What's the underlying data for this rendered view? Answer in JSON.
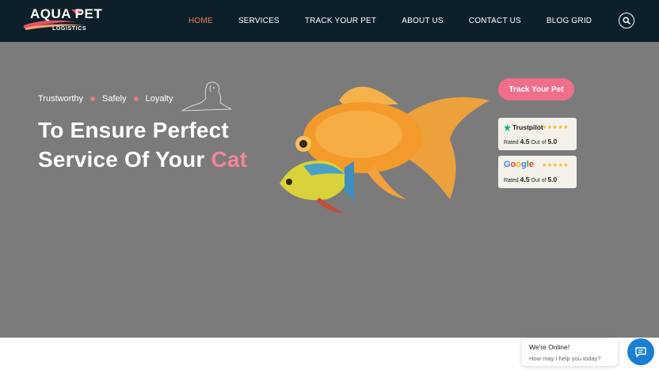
{
  "header": {
    "logo": {
      "name": "AQUA PET",
      "subtitle": "LOGISTICS"
    },
    "nav": [
      {
        "label": "HOME",
        "active": true
      },
      {
        "label": "SERVICES",
        "active": false
      },
      {
        "label": "TRACK YOUR PET",
        "active": false
      },
      {
        "label": "ABOUT US",
        "active": false
      },
      {
        "label": "CONTACT US",
        "active": false
      },
      {
        "label": "BLOG GRID",
        "active": false
      }
    ],
    "search_icon": "search-icon"
  },
  "hero": {
    "tags": [
      "Trustworthy",
      "Safely",
      "Loyalty"
    ],
    "headline_line1": "To Ensure Perfect",
    "headline_line2_prefix": "Service Of Your ",
    "headline_highlight": "Cat",
    "cta_label": "Track Your Pet",
    "ratings": [
      {
        "brand": "Trustpilot",
        "stars": "★★★★★",
        "rated_label": "Rated",
        "score": "4.5",
        "out_of_label": "Out of",
        "max": "5.0"
      },
      {
        "brand": "Google",
        "stars": "★★★★★",
        "rated_label": "Rated",
        "score": "4.5",
        "out_of_label": "Out of",
        "max": "5.0"
      }
    ]
  },
  "chat": {
    "title": "We're Online!",
    "subtitle": "How may I help you today?",
    "icon": "chat-icon"
  },
  "colors": {
    "header_bg": "#0d2029",
    "hero_bg": "#7b7b7b",
    "accent_orange": "#ef7c52",
    "accent_pink": "#f06e8a",
    "chat_blue": "#1a7fd4"
  }
}
